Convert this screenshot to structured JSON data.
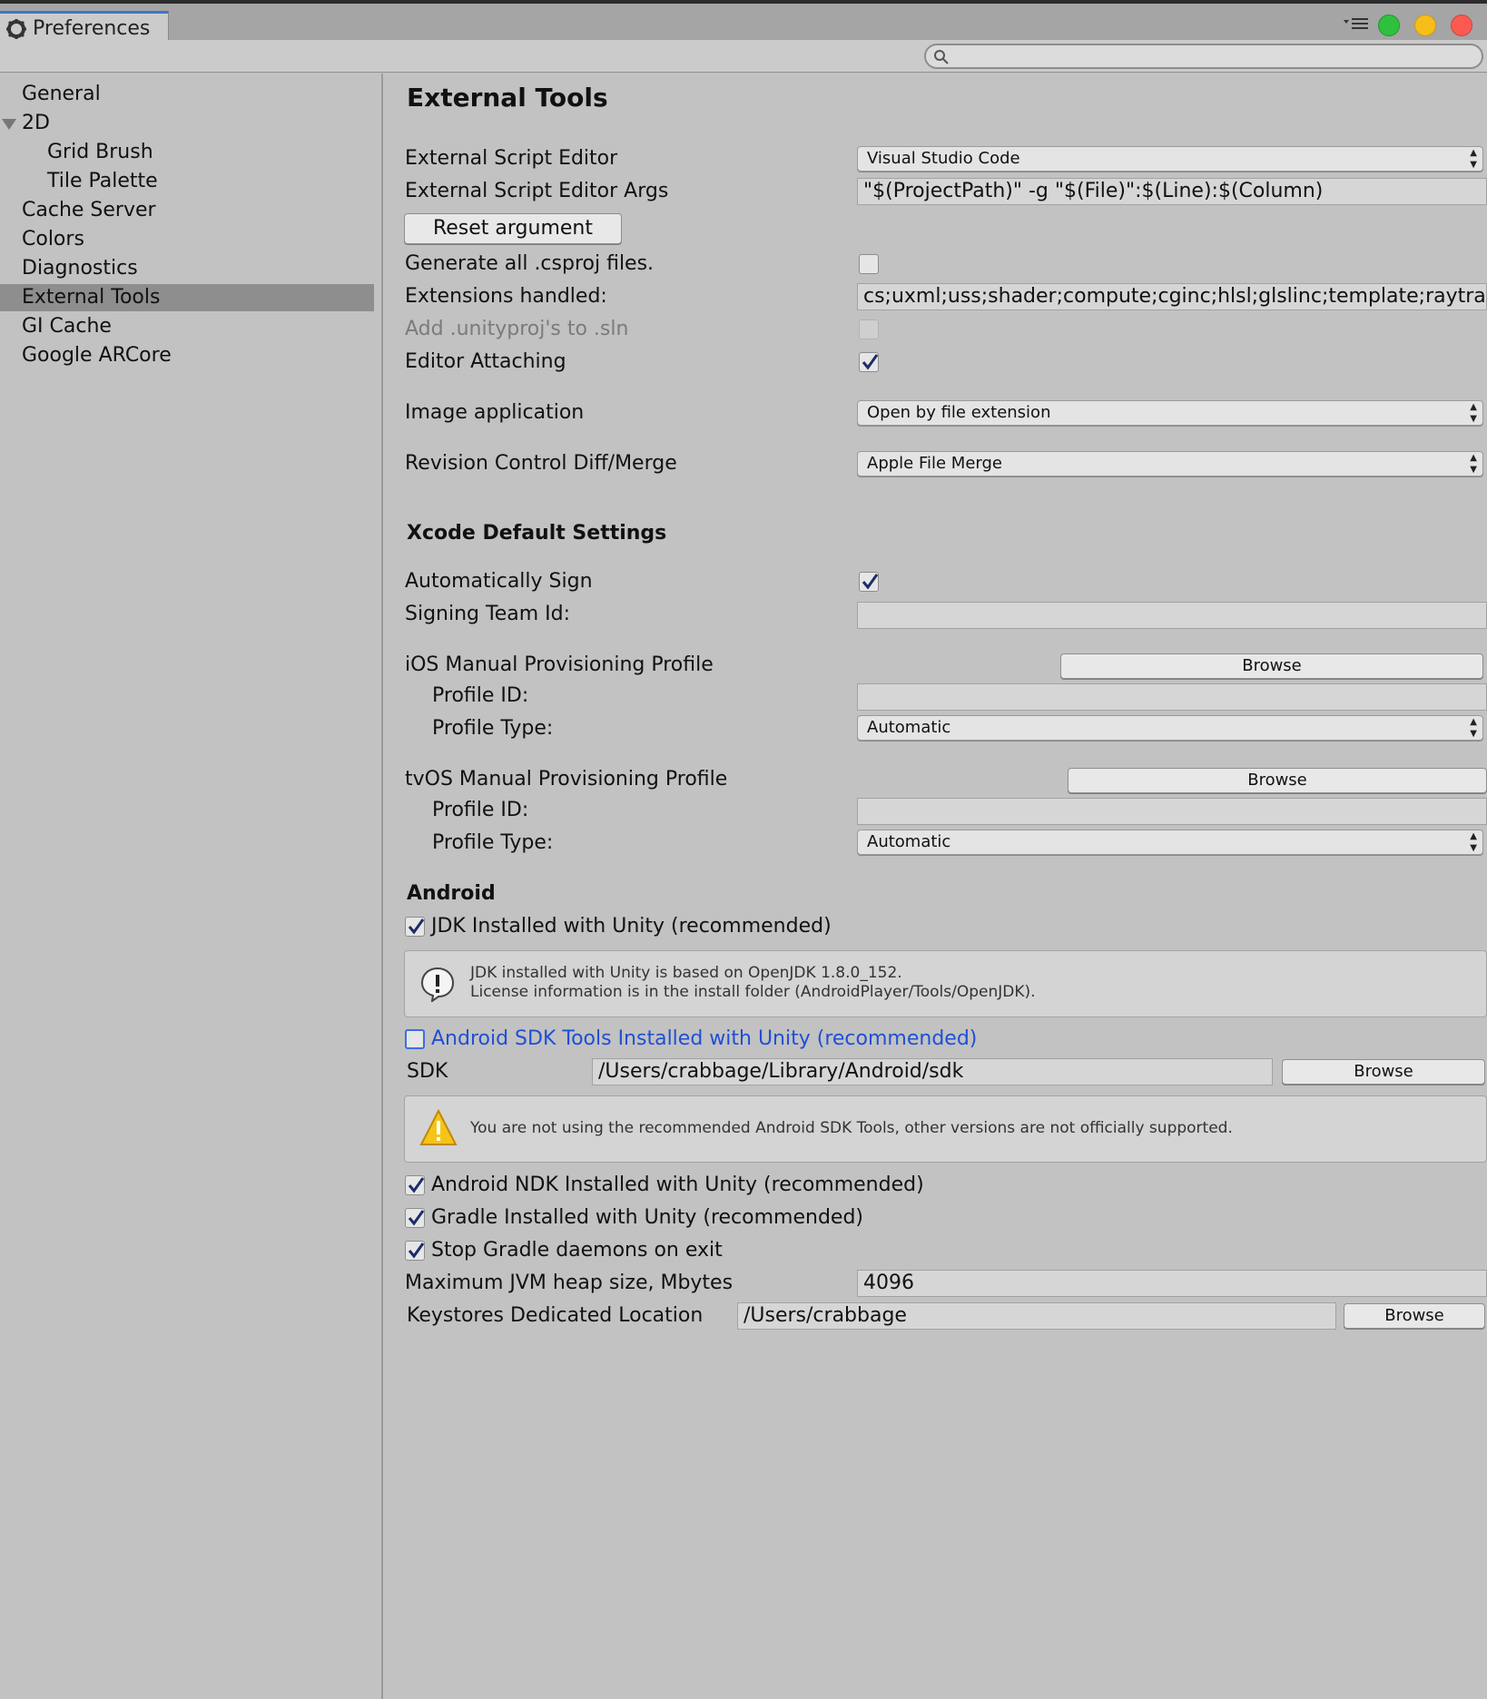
{
  "window": {
    "tab_title": "Preferences"
  },
  "search": {
    "value": "",
    "placeholder": ""
  },
  "sidebar": {
    "items": [
      {
        "label": "General"
      },
      {
        "label": "2D"
      },
      {
        "label": "Grid Brush"
      },
      {
        "label": "Tile Palette"
      },
      {
        "label": "Cache Server"
      },
      {
        "label": "Colors"
      },
      {
        "label": "Diagnostics"
      },
      {
        "label": "External Tools"
      },
      {
        "label": "GI Cache"
      },
      {
        "label": "Google ARCore"
      }
    ],
    "selected": "External Tools"
  },
  "main": {
    "title": "External Tools",
    "external_script_editor": {
      "label": "External Script Editor",
      "value": "Visual Studio Code"
    },
    "external_script_editor_args": {
      "label": "External Script Editor Args",
      "value": "\"$(ProjectPath)\" -g \"$(File)\":$(Line):$(Column)"
    },
    "reset_argument": "Reset argument",
    "generate_csproj": {
      "label": "Generate all .csproj files.",
      "checked": false
    },
    "extensions_handled": {
      "label": "Extensions handled:",
      "value": "cs;uxml;uss;shader;compute;cginc;hlsl;glslinc;template;raytrace"
    },
    "add_unityproj": {
      "label": "Add .unityproj's to .sln",
      "checked": false
    },
    "editor_attaching": {
      "label": "Editor Attaching",
      "checked": true
    },
    "image_application": {
      "label": "Image application",
      "value": "Open by file extension"
    },
    "revision_control": {
      "label": "Revision Control Diff/Merge",
      "value": "Apple File Merge"
    },
    "xcode": {
      "heading": "Xcode Default Settings",
      "auto_sign": {
        "label": "Automatically Sign",
        "checked": true
      },
      "signing_team": {
        "label": "Signing Team Id:",
        "value": ""
      },
      "ios": {
        "label": "iOS Manual Provisioning Profile",
        "browse": "Browse",
        "profile_id": {
          "label": "Profile ID:",
          "value": ""
        },
        "profile_type": {
          "label": "Profile Type:",
          "value": "Automatic"
        }
      },
      "tvos": {
        "label": "tvOS Manual Provisioning Profile",
        "browse": "Browse",
        "profile_id": {
          "label": "Profile ID:",
          "value": ""
        },
        "profile_type": {
          "label": "Profile Type:",
          "value": "Automatic"
        }
      }
    },
    "android": {
      "heading": "Android",
      "jdk": {
        "label": "JDK Installed with Unity (recommended)",
        "checked": true
      },
      "jdk_info_line1": "JDK installed with Unity is based on OpenJDK 1.8.0_152.",
      "jdk_info_line2": "License information is in the install folder (AndroidPlayer/Tools/OpenJDK).",
      "sdk_tools": {
        "label": "Android SDK Tools Installed with Unity (recommended)",
        "checked": false
      },
      "sdk": {
        "label": "SDK",
        "value": "/Users/crabbage/Library/Android/sdk",
        "browse": "Browse"
      },
      "sdk_warning": "You are not using the recommended Android SDK Tools, other versions are not officially supported.",
      "ndk": {
        "label": "Android NDK Installed with Unity (recommended)",
        "checked": true
      },
      "gradle": {
        "label": "Gradle Installed with Unity (recommended)",
        "checked": true
      },
      "stop_gradle": {
        "label": "Stop Gradle daemons on exit",
        "checked": true
      },
      "jvm_heap": {
        "label": "Maximum JVM heap size, Mbytes",
        "value": "4096"
      },
      "keystores": {
        "label": "Keystores Dedicated Location",
        "value": "/Users/crabbage",
        "browse": "Browse"
      }
    }
  },
  "colors": {
    "accent": "#3b78c9",
    "selected_row": "#8e8e8e",
    "link_blue": "#1f4fd6",
    "traffic_green": "#2fc13e",
    "traffic_yellow": "#f7bd1a",
    "traffic_red": "#fb5a52"
  }
}
